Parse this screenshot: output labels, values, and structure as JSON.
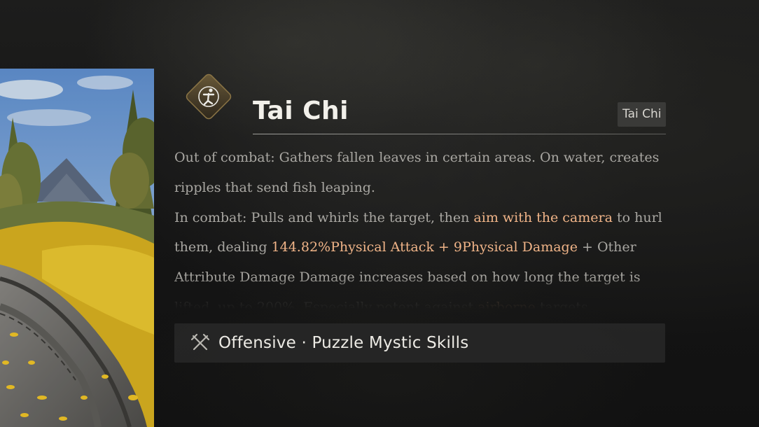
{
  "skill": {
    "title": "Tai Chi",
    "tag": "Tai Chi",
    "icon": "archer-figure-icon"
  },
  "description": {
    "line1": "Out of combat: Gathers fallen leaves in certain areas. On water, creates ripples that send fish leaping.",
    "line2_before": "In combat: Pulls and whirls the target, then ",
    "line2_highlight1": "aim with the camera",
    "line2_middle": " to hurl them, dealing ",
    "line2_highlight2": "144.82%Physical Attack + 9Physical Damage",
    "line2_after": " + Other Attribute Damage Damage increases based on how long the target is lifted, up to 200%. Especially potent against ",
    "line2_highlight3": "airborne",
    "line2_end": " targets."
  },
  "category": {
    "icon": "crossed-swords-icon",
    "label": "Offensive · Puzzle Mystic Skills"
  },
  "colors": {
    "title": "#f2f0ea",
    "body_text": "#a9a7a2",
    "highlight": "#f0b488",
    "badge_gold": "#c9a35a",
    "panel": "#282828"
  }
}
